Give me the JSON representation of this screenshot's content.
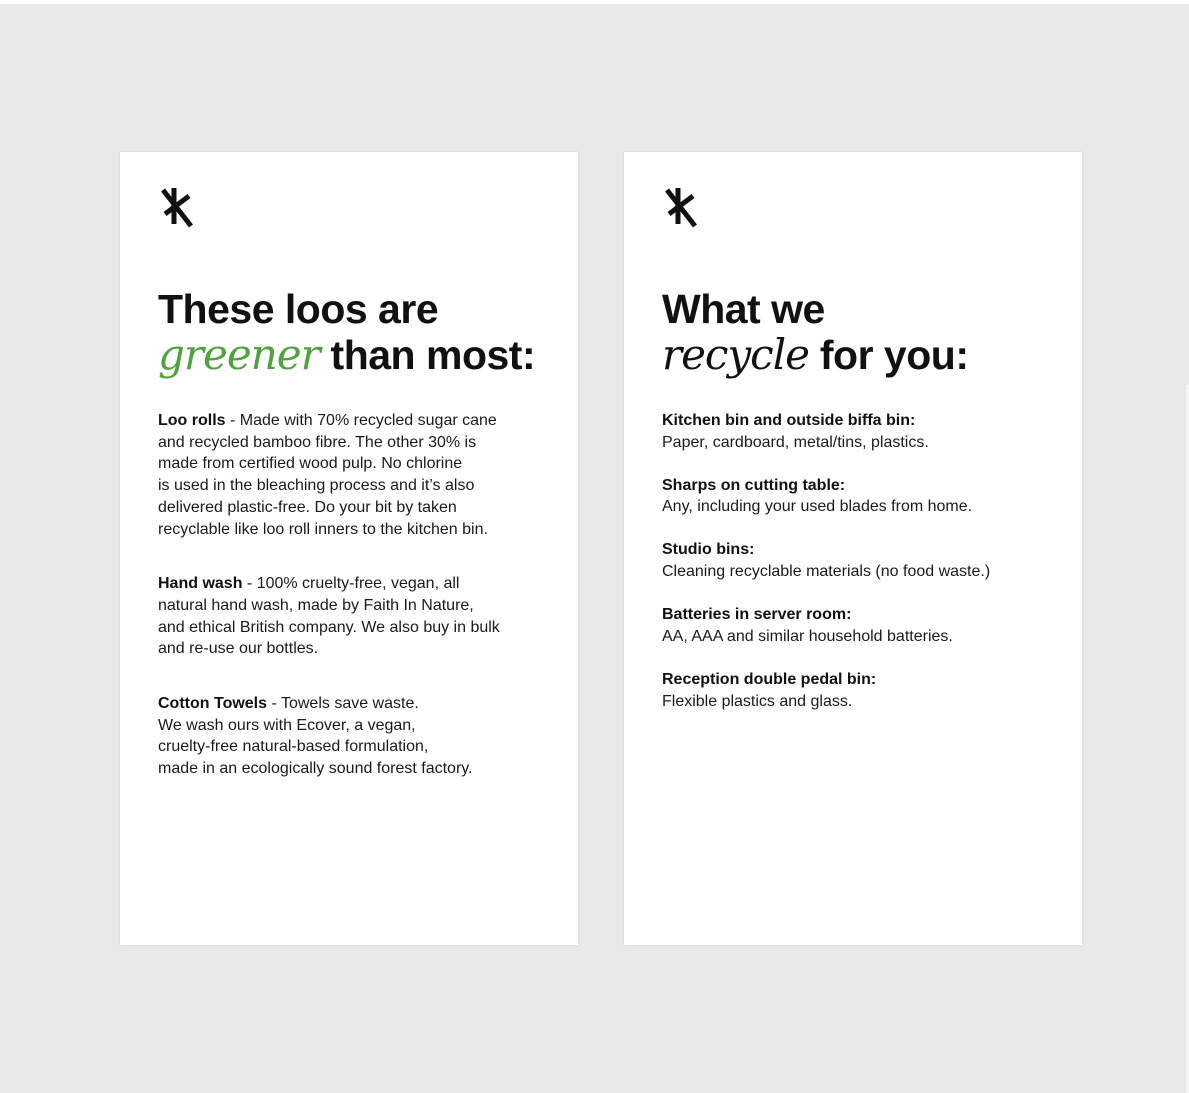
{
  "left_card": {
    "heading": {
      "line1": "These loos are",
      "accent": "greener",
      "rest": " than most:"
    },
    "paragraphs": [
      {
        "title": "Loo rolls",
        "first": " - Made with 70% recycled sugar cane",
        "lines": [
          "and recycled bamboo fibre. The other 30% is",
          "made from certified wood pulp. No chlorine",
          "is used in the bleaching process and it’s also",
          "delivered plastic-free. Do your bit by taken",
          "recyclable like loo roll inners to the kitchen bin."
        ]
      },
      {
        "title": "Hand wash",
        "first": " - 100% cruelty-free, vegan, all",
        "lines": [
          "natural hand wash, made by Faith In Nature,",
          "and ethical British company. We also buy in bulk",
          "and re-use our bottles."
        ]
      },
      {
        "title": "Cotton Towels",
        "first": " - Towels save waste.",
        "lines": [
          "We wash ours with Ecover, a vegan,",
          "cruelty-free natural-based formulation,",
          "made in an ecologically sound forest factory."
        ]
      }
    ]
  },
  "right_card": {
    "heading": {
      "line1": "What we",
      "accent": "recycle",
      "rest": " for you:"
    },
    "items": [
      {
        "title": "Kitchen bin and outside biffa bin:",
        "desc": "Paper, cardboard, metal/tins, plastics."
      },
      {
        "title": "Sharps on cutting table:",
        "desc": "Any, including your used blades from home."
      },
      {
        "title": "Studio bins:",
        "desc": "Cleaning recyclable materials (no food waste.)"
      },
      {
        "title": "Batteries in server room:",
        "desc": "AA, AAA and similar household batteries."
      },
      {
        "title": "Reception double pedal bin:",
        "desc": "Flexible plastics and glass."
      }
    ]
  },
  "colors": {
    "background": "#e8e8e8",
    "card": "#ffffff",
    "accent_green": "#4fa33f",
    "text": "#111111"
  },
  "icons": {
    "logo": "crossed-k-logo-icon"
  }
}
